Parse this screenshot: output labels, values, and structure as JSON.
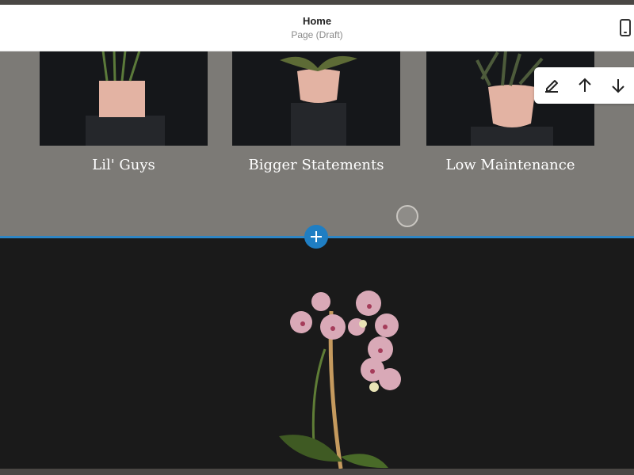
{
  "header": {
    "title": "Home",
    "subtitle": "Page (Draft)",
    "device_icon": "mobile-preview-icon"
  },
  "gallery": {
    "items": [
      {
        "label": "Lil' Guys"
      },
      {
        "label": "Bigger Statements"
      },
      {
        "label": "Low Maintenance"
      }
    ]
  },
  "toolbar": {
    "icons": [
      "edit-icon",
      "move-up-icon",
      "move-down-icon"
    ]
  },
  "colors": {
    "accent": "#1f7ec3",
    "section_grey": "#7c7a76",
    "section_dark": "#1a1a1a"
  }
}
